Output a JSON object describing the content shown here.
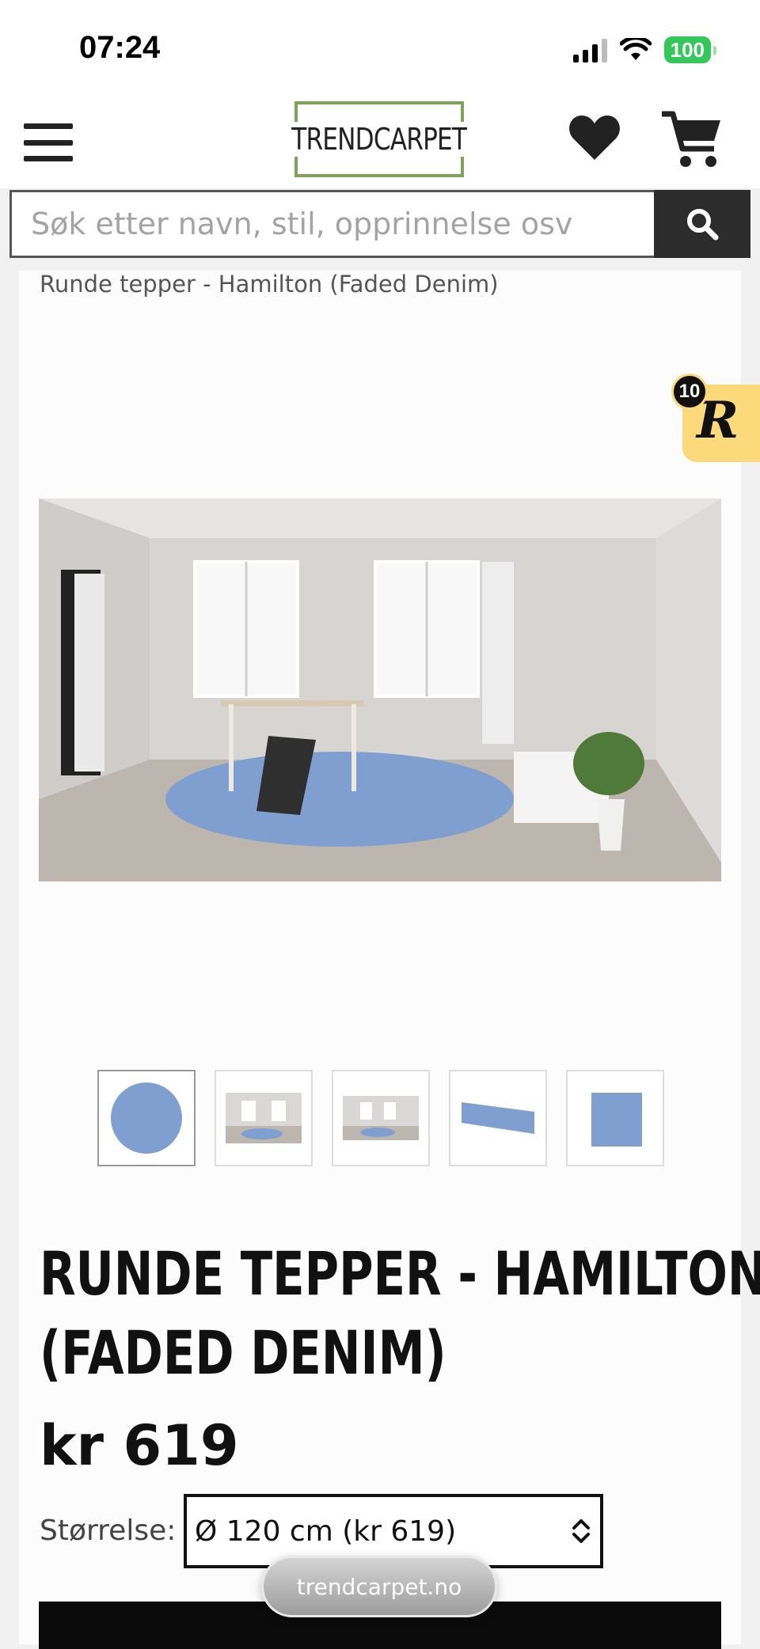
{
  "status_bar": {
    "time": "07:24",
    "battery": "100"
  },
  "header": {
    "logo_text": "TRENDCARPET"
  },
  "search": {
    "placeholder": "Søk etter navn, stil, opprinnelse osv"
  },
  "breadcrumb": "Runde tepper - Hamilton (Faded Denim)",
  "reward_badge": {
    "count": "10",
    "letter": "R"
  },
  "product": {
    "title_line1": "RUNDE TEPPER - HAMILTON",
    "title_line2": "(FADED DENIM)",
    "price": "kr 619",
    "size_label": "Størrelse:",
    "size_selected": "Ø 120 cm (kr 619)"
  },
  "browser": {
    "url": "trendcarpet.no"
  },
  "colors": {
    "logo_border": "#7da25a",
    "rug_blue": "#7f9fd1",
    "reward_yellow": "#fcd97a",
    "battery_green": "#34c759"
  },
  "icons": [
    "menu-icon",
    "heart-icon",
    "cart-icon",
    "search-icon",
    "chevrons-updown-icon"
  ]
}
